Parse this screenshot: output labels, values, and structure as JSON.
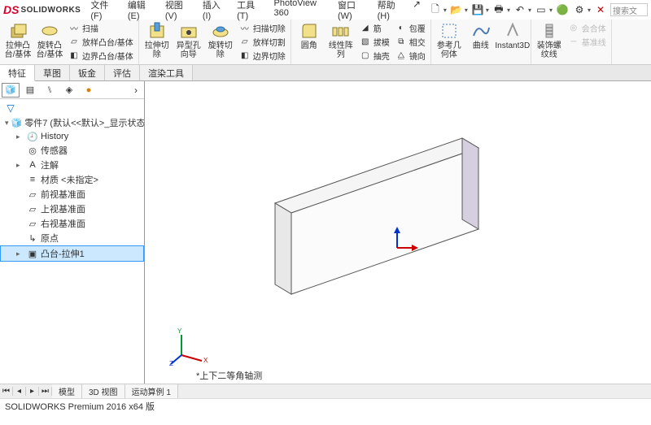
{
  "app": {
    "brand": "SOLIDWORKS"
  },
  "menu": {
    "file": "文件(F)",
    "edit": "编辑(E)",
    "view": "视图(V)",
    "insert": "插入(I)",
    "tools": "工具(T)",
    "photoview": "PhotoView 360",
    "window": "窗口(W)",
    "help": "帮助(H)"
  },
  "search": {
    "placeholder": "搜索文"
  },
  "ribbon": {
    "extrude": "拉伸凸\n台/基体",
    "revolve": "旋转凸\n台/基体",
    "sweep": "扫描",
    "loft": "放样凸台/基体",
    "boundary": "边界凸台/基体",
    "extrude_cut": "拉伸切\n除",
    "hole": "异型孔\n向导",
    "revolve_cut": "旋转切\n除",
    "sweep_cut": "扫描切除",
    "loft_cut": "放样切割",
    "boundary_cut": "边界切除",
    "fillet": "圆角",
    "pattern": "线性阵\n列",
    "rib": "筋",
    "draft": "拔模",
    "shell": "抽壳",
    "wrap": "包覆",
    "intersect": "相交",
    "mirror": "镜向",
    "refgeo": "参考几\n何体",
    "curves": "曲线",
    "instant3d": "Instant3D",
    "thread": "装饰螺\n纹线",
    "combine": "会合体",
    "baseline": "基准线"
  },
  "tabs": {
    "feature": "特征",
    "sketch": "草图",
    "sheet": "钣金",
    "eval": "评估",
    "render": "渲染工具"
  },
  "tree": {
    "root": "零件7 (默认<<默认>_显示状态 1>)",
    "history": "History",
    "sensors": "传感器",
    "annotations": "注解",
    "material": "材质 <未指定>",
    "front": "前视基准面",
    "top": "上视基准面",
    "right": "右视基准面",
    "origin": "原点",
    "feat1": "凸台-拉伸1"
  },
  "view_label": "*上下二等角轴测",
  "bottom": {
    "model": "模型",
    "v3d": "3D 视图",
    "motion": "运动算例 1"
  },
  "status": "SOLIDWORKS Premium 2016 x64 版"
}
